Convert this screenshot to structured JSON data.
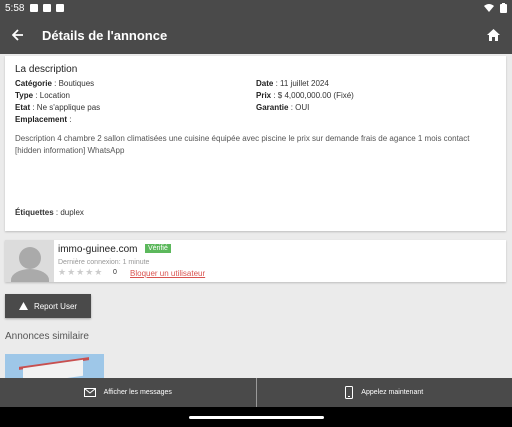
{
  "status": {
    "time": "5:58"
  },
  "appbar": {
    "title": "Détails de l'annonce"
  },
  "details": {
    "heading": "La description",
    "category_label": "Catégorie",
    "category_value": " : Boutiques",
    "date_label": "Date",
    "date_value": " : 11 juillet 2024",
    "type_label": "Type",
    "type_value": " : Location",
    "price_label": "Prix",
    "price_value": " : $ 4,000,000.00 (Fixé)",
    "etat_label": "Etat",
    "etat_value": " : Ne s'applique pas",
    "garantie_label": "Garantie",
    "garantie_value": " : OUI",
    "location_label": "Emplacement",
    "location_value": " :",
    "description": "Description 4 chambre 2 sallon climatisées une cuisine équipée avec piscine le prix sur demande frais de agance 1 mois contact [hidden information] WhatsApp",
    "tags_label": "Étiquettes",
    "tags_value": " : duplex"
  },
  "user": {
    "name": "immo-guinee.com",
    "badge": "Vérifié",
    "last_connection": "Dernière connexion: 1 minute",
    "stars": "★★★★★",
    "rating_count": "0",
    "block_link": "Bloquer un utilisateur"
  },
  "report_button": "Report User",
  "similar_heading": "Annonces similaire",
  "bottom": {
    "messages": "Afficher les messages",
    "call": "Appelez maintenant"
  }
}
